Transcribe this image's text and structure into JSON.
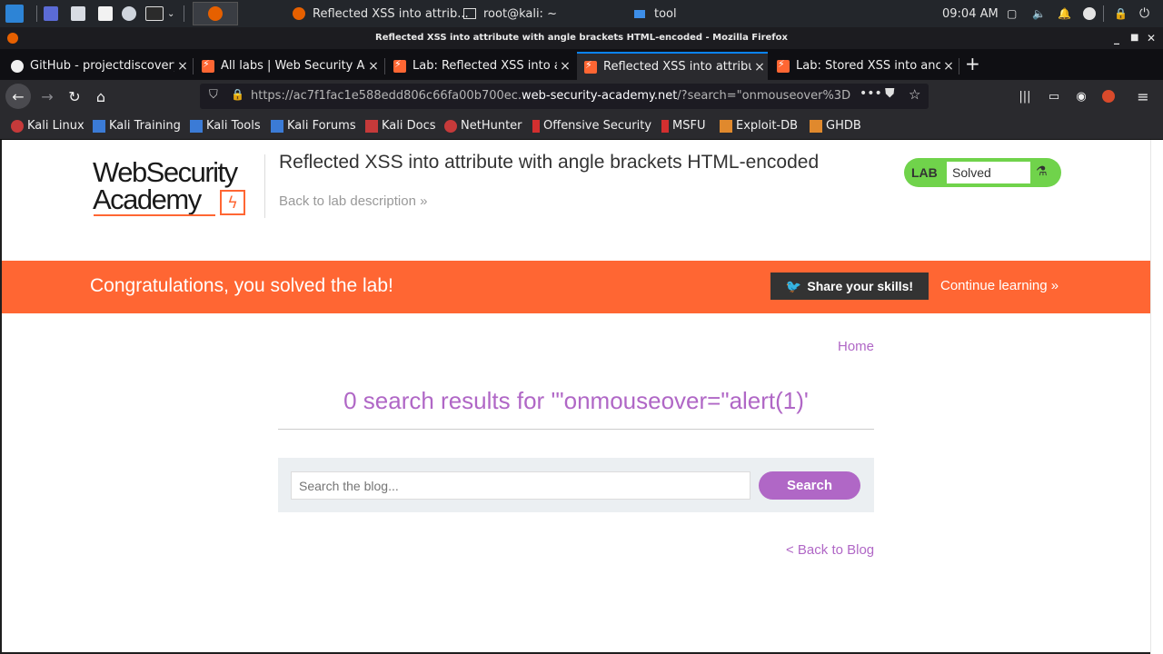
{
  "taskbar": {
    "windows": [
      "Reflected XSS into attrib...",
      "root@kali: ~",
      "tool"
    ],
    "clock": "09:04 AM"
  },
  "firefox": {
    "window_title": "Reflected XSS into attribute with angle brackets HTML-encoded - Mozilla Firefox",
    "tabs": [
      {
        "label": "GitHub - projectdiscovery",
        "active": false
      },
      {
        "label": "All labs | Web Security Ac",
        "active": false
      },
      {
        "label": "Lab: Reflected XSS into a",
        "active": false
      },
      {
        "label": "Reflected XSS into attribu",
        "active": true
      },
      {
        "label": "Lab: Stored XSS into anch",
        "active": false
      }
    ],
    "url_prefix": "https://ac7f1fac1e588edd806c66fa00b700ec.",
    "url_domain": "web-security-academy.net",
    "url_suffix": "/?search=\"onmouseover%3D",
    "bookmarks": [
      "Kali Linux",
      "Kali Training",
      "Kali Tools",
      "Kali Forums",
      "Kali Docs",
      "NetHunter",
      "Offensive Security",
      "MSFU",
      "Exploit-DB",
      "GHDB"
    ]
  },
  "page": {
    "logo_line1": "WebSecurity",
    "logo_line2": "Academy",
    "lab_title": "Reflected XSS into attribute with angle brackets HTML-encoded",
    "back_to_description": "Back to lab description »",
    "lab_badge": "LAB",
    "lab_status": "Solved",
    "banner_message": "Congratulations, you solved the lab!",
    "share_label": "Share your skills!",
    "continue_label": "Continue learning »",
    "home_link": "Home",
    "results_heading": "0 search results for '\"onmouseover=\"alert(1)'",
    "search_placeholder": "Search the blog...",
    "search_button": "Search",
    "back_to_blog": "< Back to Blog"
  },
  "colors": {
    "accent_orange": "#ff6633",
    "accent_purple": "#b067c6",
    "lab_green": "#70d34b"
  }
}
